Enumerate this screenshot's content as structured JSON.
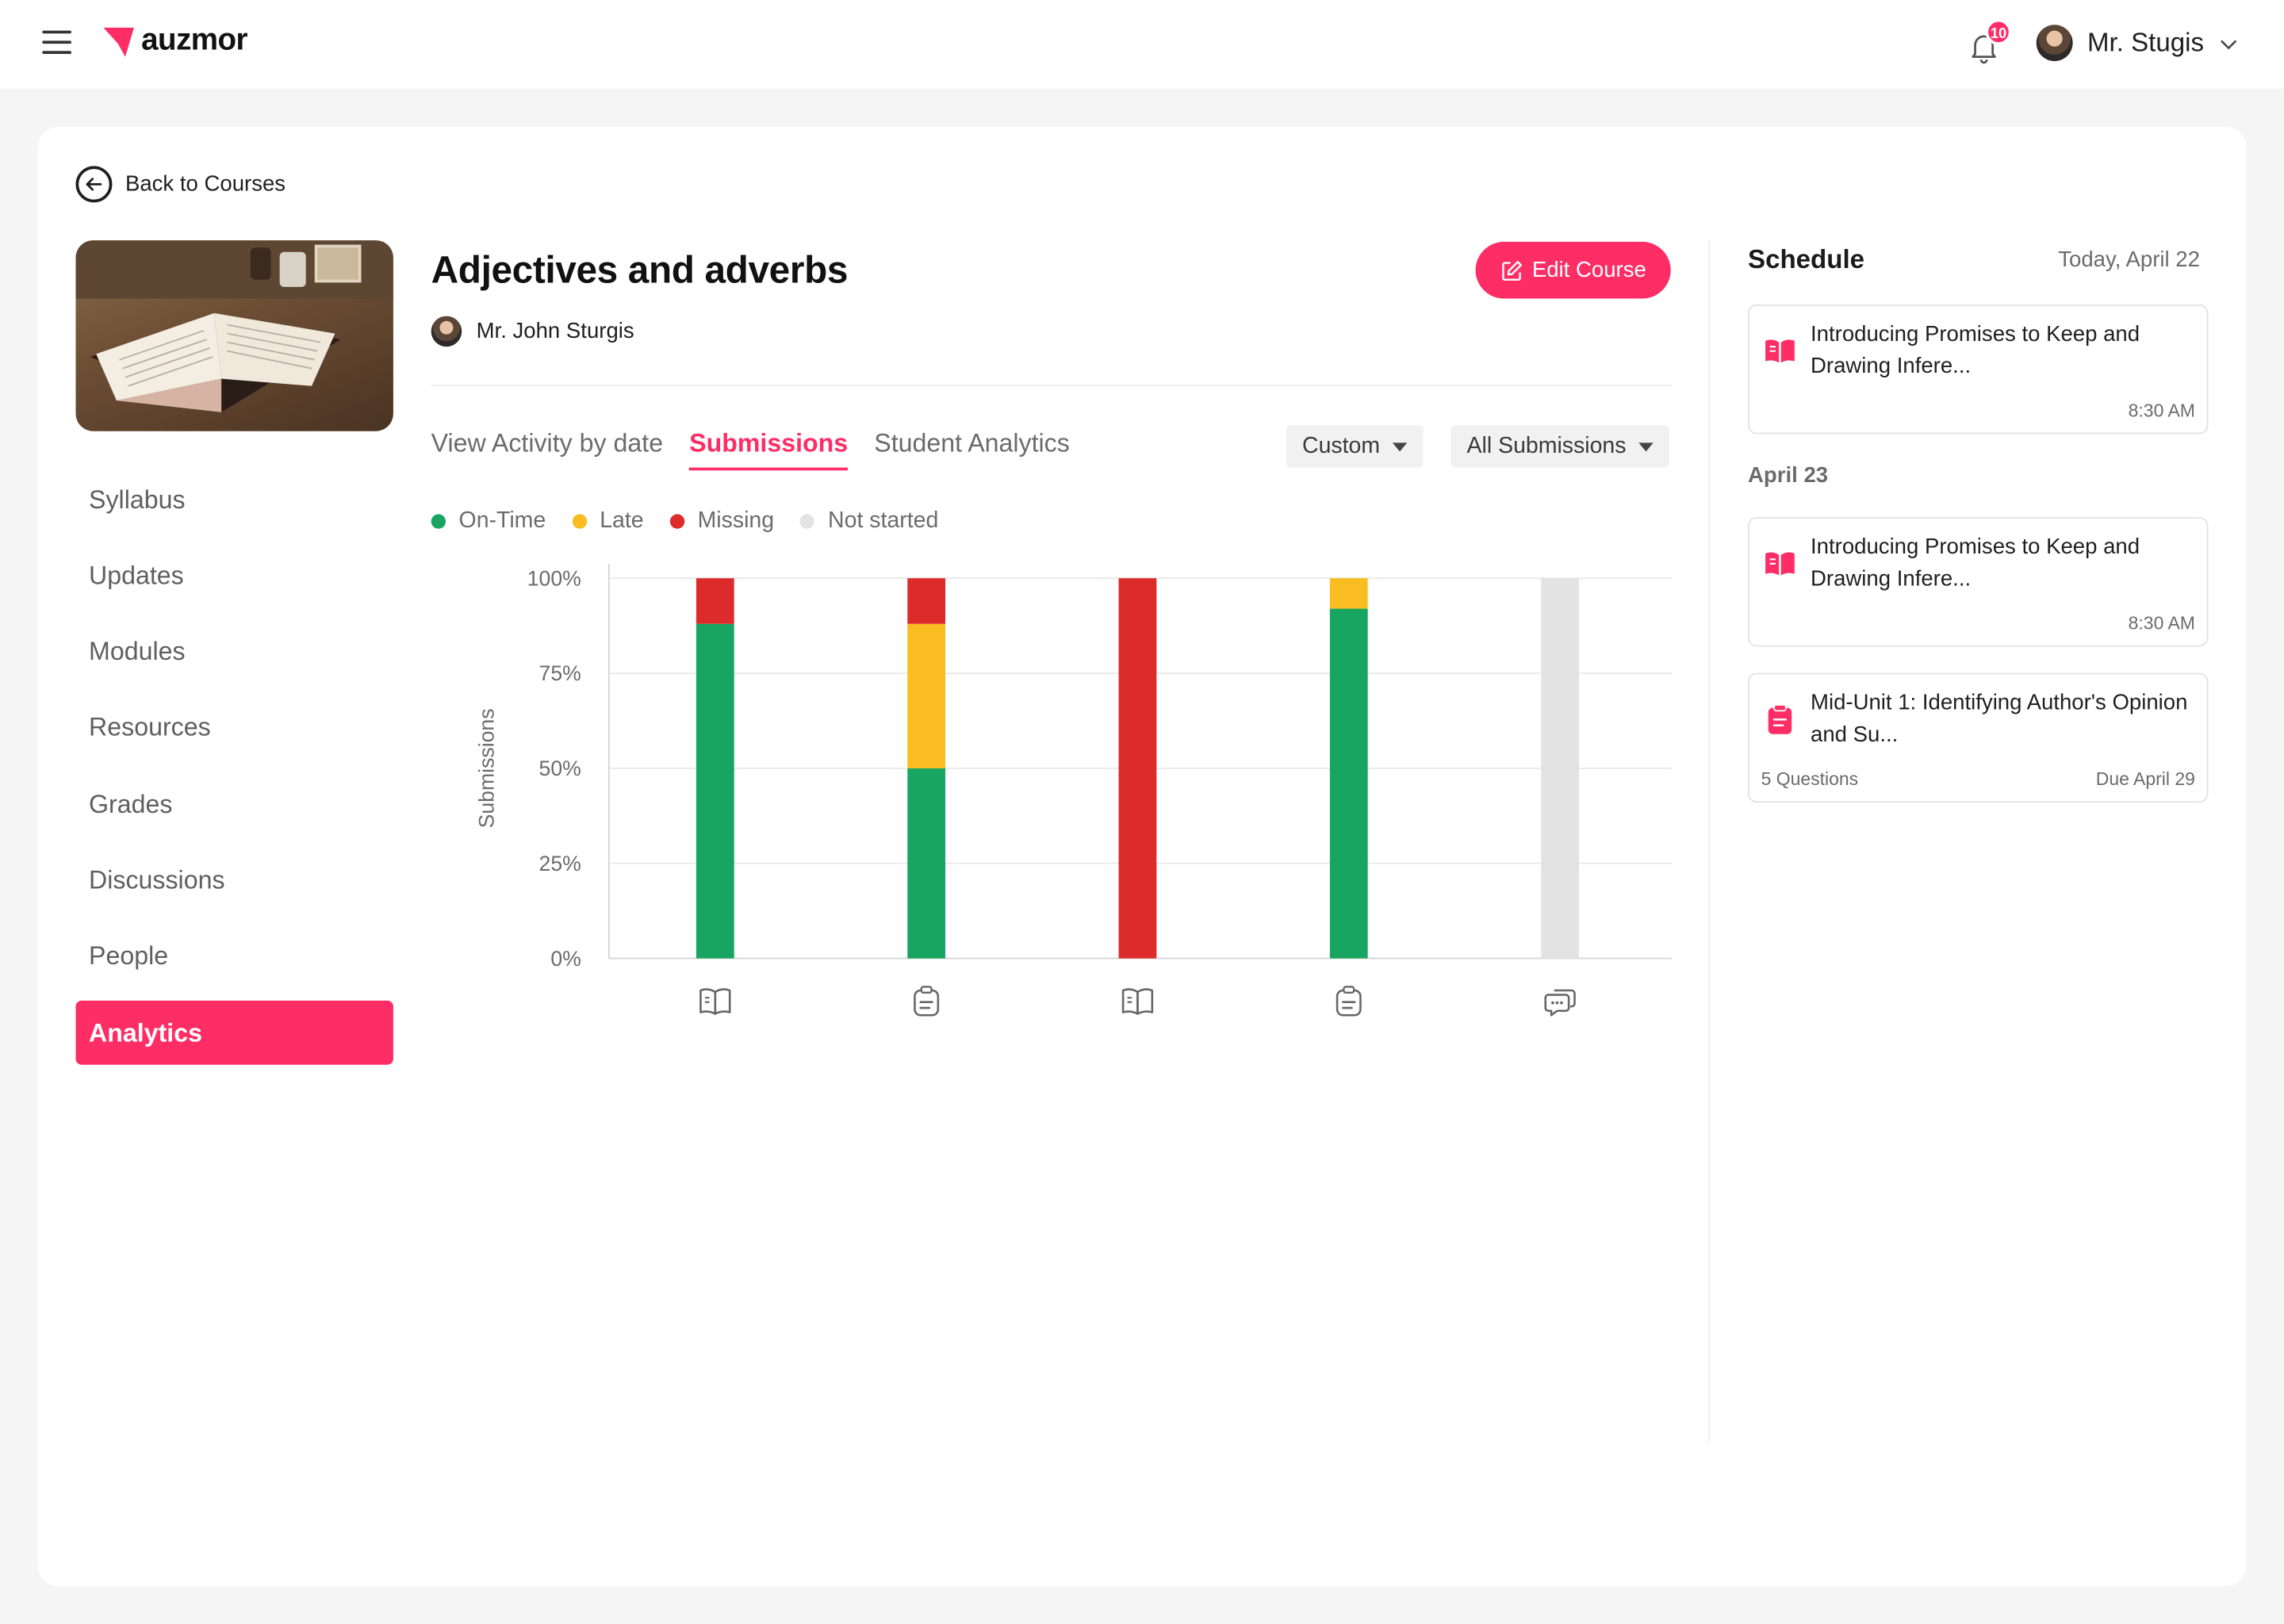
{
  "brand": {
    "name": "auzmor",
    "accent": "#ff2d66"
  },
  "notifications": {
    "count": "10"
  },
  "user": {
    "name": "Mr. Stugis"
  },
  "back": {
    "label": "Back to Courses"
  },
  "course": {
    "title": "Adjectives and adverbs",
    "author": "Mr. John Sturgis",
    "edit_label": "Edit Course"
  },
  "sidebar": {
    "items": [
      {
        "label": "Syllabus"
      },
      {
        "label": "Updates"
      },
      {
        "label": "Modules"
      },
      {
        "label": "Resources"
      },
      {
        "label": "Grades"
      },
      {
        "label": "Discussions"
      },
      {
        "label": "People"
      },
      {
        "label": "Analytics",
        "active": true
      }
    ]
  },
  "tabs": [
    {
      "label": "View Activity by date"
    },
    {
      "label": "Submissions",
      "active": true
    },
    {
      "label": "Student Analytics"
    }
  ],
  "filters": {
    "range": "Custom",
    "submissions": "All Submissions"
  },
  "chart_data": {
    "type": "bar",
    "stacked": true,
    "ylabel": "Submissions",
    "ylim": [
      0,
      100
    ],
    "yticks": [
      "0%",
      "25%",
      "50%",
      "75%",
      "100%"
    ],
    "categories": [
      "reading",
      "assignment",
      "reading",
      "assignment",
      "discussion"
    ],
    "category_icons": [
      "book-icon",
      "clipboard-icon",
      "book-icon",
      "clipboard-icon",
      "chat-icon"
    ],
    "series": [
      {
        "name": "On-Time",
        "color": "#17a561",
        "values": [
          88,
          50,
          0,
          92,
          0
        ]
      },
      {
        "name": "Late",
        "color": "#f9bd22",
        "values": [
          0,
          38,
          0,
          8,
          0
        ]
      },
      {
        "name": "Missing",
        "color": "#dd2a2a",
        "values": [
          12,
          12,
          100,
          0,
          0
        ]
      },
      {
        "name": "Not started",
        "color": "#e3e3e3",
        "values": [
          0,
          0,
          0,
          0,
          100
        ]
      }
    ],
    "grid": true,
    "legend": "top-left"
  },
  "schedule": {
    "title": "Schedule",
    "today": "Today, April 22",
    "group2": "April 23",
    "cards": [
      {
        "text": "Introducing Promises to Keep and Drawing Infere...",
        "time": "8:30 AM",
        "icon": "book-icon"
      },
      {
        "text": "Introducing Promises to Keep and Drawing Infere...",
        "time": "8:30 AM",
        "icon": "book-icon"
      },
      {
        "text": "Mid-Unit 1: Identifying Author's Opinion and Su...",
        "meta": "5 Questions",
        "due": "Due April 29",
        "icon": "clipboard-icon"
      }
    ]
  }
}
